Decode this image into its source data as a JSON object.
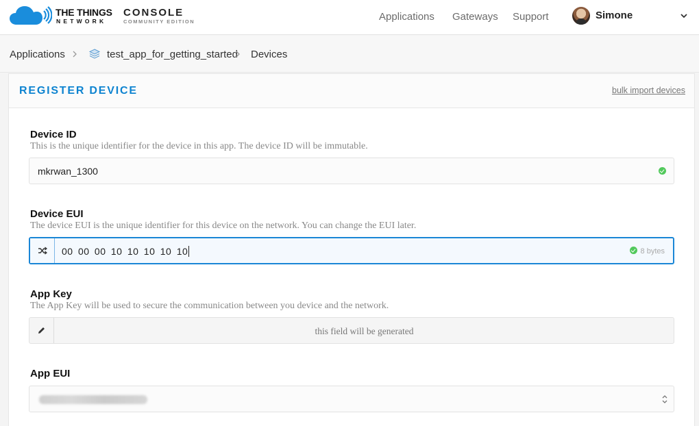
{
  "brand": {
    "line1": "THE THINGS",
    "line2": "NETWORK",
    "console": "CONSOLE",
    "edition": "COMMUNITY EDITION"
  },
  "nav": {
    "applications": "Applications",
    "gateways": "Gateways",
    "support": "Support",
    "user_name": "Simone"
  },
  "breadcrumb": {
    "applications": "Applications",
    "app": "test_app_for_getting_started",
    "devices": "Devices"
  },
  "card": {
    "title": "REGISTER DEVICE",
    "bulk_link": "bulk import devices"
  },
  "fields": {
    "device_id": {
      "label": "Device ID",
      "help": "This is the unique identifier for the device in this app. The device ID will be immutable.",
      "value": "mkrwan_1300"
    },
    "device_eui": {
      "label": "Device EUI",
      "help": "The device EUI is the unique identifier for this device on the network. You can change the EUI later.",
      "value": "00 00 00 10 10 10 10 10",
      "bytes_note": "8 bytes"
    },
    "app_key": {
      "label": "App Key",
      "help": "The App Key will be used to secure the communication between you device and the network.",
      "placeholder": "this field will be generated"
    },
    "app_eui": {
      "label": "App EUI"
    }
  },
  "colors": {
    "accent": "#0d83d0",
    "focus_border": "#1a86d6",
    "valid": "#52c95c"
  },
  "icons": {
    "logo": "ttn-cloud-icon",
    "shuffle": "shuffle-icon",
    "edit": "pencil-icon",
    "app": "layers-icon"
  }
}
